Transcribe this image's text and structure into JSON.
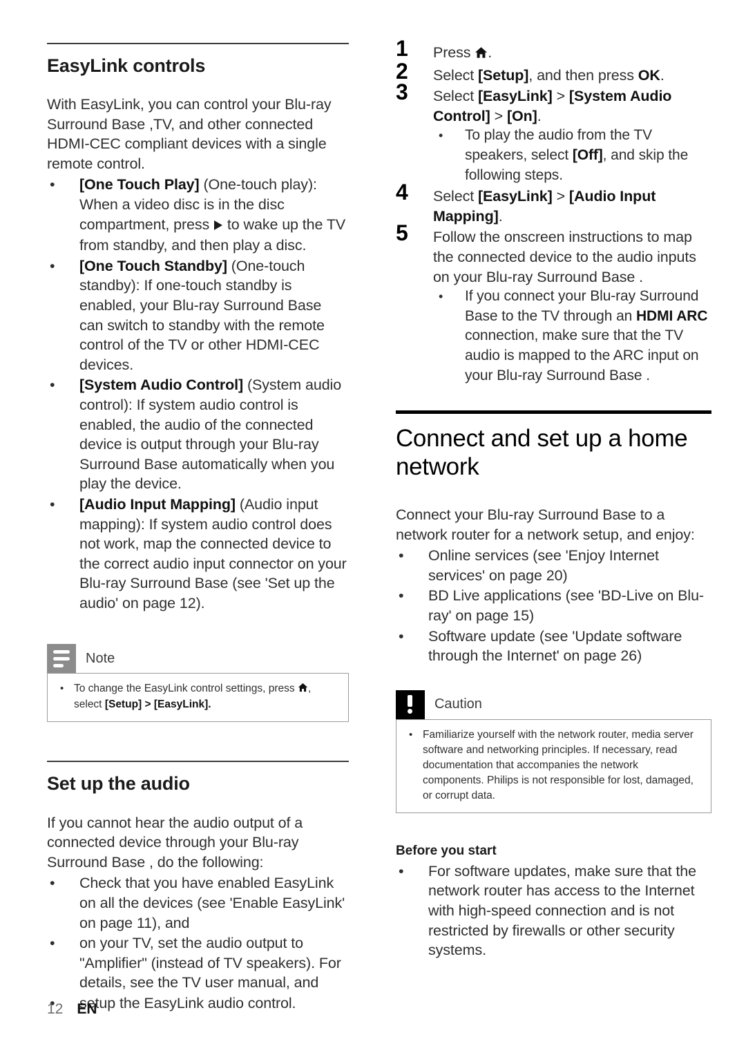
{
  "document": {
    "footer": {
      "page_number": "12",
      "language": "EN"
    }
  },
  "left_column": {
    "section1": {
      "heading": "EasyLink controls",
      "intro": "With EasyLink, you can control your Blu-ray Surround Base ,TV, and other connected HDMI-CEC compliant devices with a single remote control.",
      "bullets": [
        {
          "term": "[One Touch Play]",
          "text": " (One-touch play): When a video disc is in the disc compartment, press ",
          "icon": "play-icon",
          "text_after": " to wake up the TV from standby, and then play a disc."
        },
        {
          "term": "[One Touch Standby]",
          "text": " (One-touch standby): If one-touch standby is enabled, your Blu-ray Surround Base  can switch to standby with the remote control of the TV or other HDMI-CEC devices."
        },
        {
          "term": "[System Audio Control]",
          "text": " (System audio control): If system audio control is enabled, the audio of the connected device is output through your Blu-ray Surround Base  automatically when you play the device."
        },
        {
          "term": "[Audio Input Mapping]",
          "text": " (Audio input mapping): If system audio control does not work, map the connected device to the correct audio input connector on your Blu-ray Surround Base  (see 'Set up the audio' on page 12)."
        }
      ]
    },
    "note_box": {
      "icon": "note-icon",
      "title": "Note",
      "bullet_prefix": "To change the EasyLink control settings, press ",
      "bullet_icon": "home-icon",
      "bullet_middle": ", select ",
      "bullet_bold_1": "[Setup]",
      "bullet_sep": " > ",
      "bullet_bold_2": "[EasyLink]",
      "bullet_suffix": "."
    },
    "section2": {
      "heading": "Set up the audio",
      "intro": "If you cannot hear the audio output of a connected device through your Blu-ray Surround Base , do the following:",
      "bullets": [
        "Check that you have enabled EasyLink on all the devices (see 'Enable EasyLink' on page 11), and",
        "on your TV, set the audio output to \"Amplifier\" (instead of TV speakers). For details, see the TV user manual, and",
        "setup the EasyLink audio control."
      ]
    }
  },
  "right_column": {
    "steps": [
      {
        "number": "1",
        "text_before": "Press ",
        "icon": "home-icon",
        "text_after": "."
      },
      {
        "number": "2",
        "text_before": "Select ",
        "bold_1": "[Setup]",
        "text_mid": ", and then press ",
        "bold_2": "OK",
        "text_after": "."
      },
      {
        "number": "3",
        "text_before": "Select ",
        "bold_1": "[EasyLink]",
        "text_mid": " > ",
        "bold_2": "[System Audio Control]",
        "text_mid2": " > ",
        "bold_3": "[On]",
        "text_after": ".",
        "sub_bullets": [
          {
            "text_before": "To play the audio from the TV speakers, select ",
            "bold_1": "[Off]",
            "text_after": ", and skip the following steps."
          }
        ]
      },
      {
        "number": "4",
        "text_before": "Select ",
        "bold_1": "[EasyLink]",
        "text_mid": " > ",
        "bold_2": "[Audio Input Mapping]",
        "text_after": "."
      },
      {
        "number": "5",
        "text_before": "Follow the onscreen instructions to map the connected device to the audio inputs on your Blu-ray Surround Base .",
        "sub_bullets": [
          {
            "text_before": "If you connect your Blu-ray Surround Base  to the TV through an ",
            "bold_1": "HDMI ARC",
            "text_after": " connection, make sure that the TV audio is mapped to the ARC input on your Blu-ray Surround Base ."
          }
        ]
      }
    ],
    "section": {
      "heading": "Connect and set up a home network",
      "intro": "Connect your Blu-ray Surround Base  to a network router for a network setup, and enjoy:",
      "bullets": [
        "Online services (see 'Enjoy Internet services' on page 20)",
        "BD Live applications (see 'BD-Live on Blu-ray' on page 15)",
        "Software update (see 'Update software through the Internet' on page 26)"
      ]
    },
    "caution_box": {
      "icon": "caution-icon",
      "title": "Caution",
      "bullets": [
        "Familiarize yourself with the network router, media server software and networking principles. If necessary, read documentation that accompanies the network components. Philips is not responsible for lost, damaged, or corrupt data."
      ]
    },
    "before_you_start": {
      "heading": "Before you start",
      "bullets": [
        "For software updates, make sure that the network router has access to the Internet with high-speed connection and is not restricted by firewalls or other security systems."
      ]
    }
  }
}
